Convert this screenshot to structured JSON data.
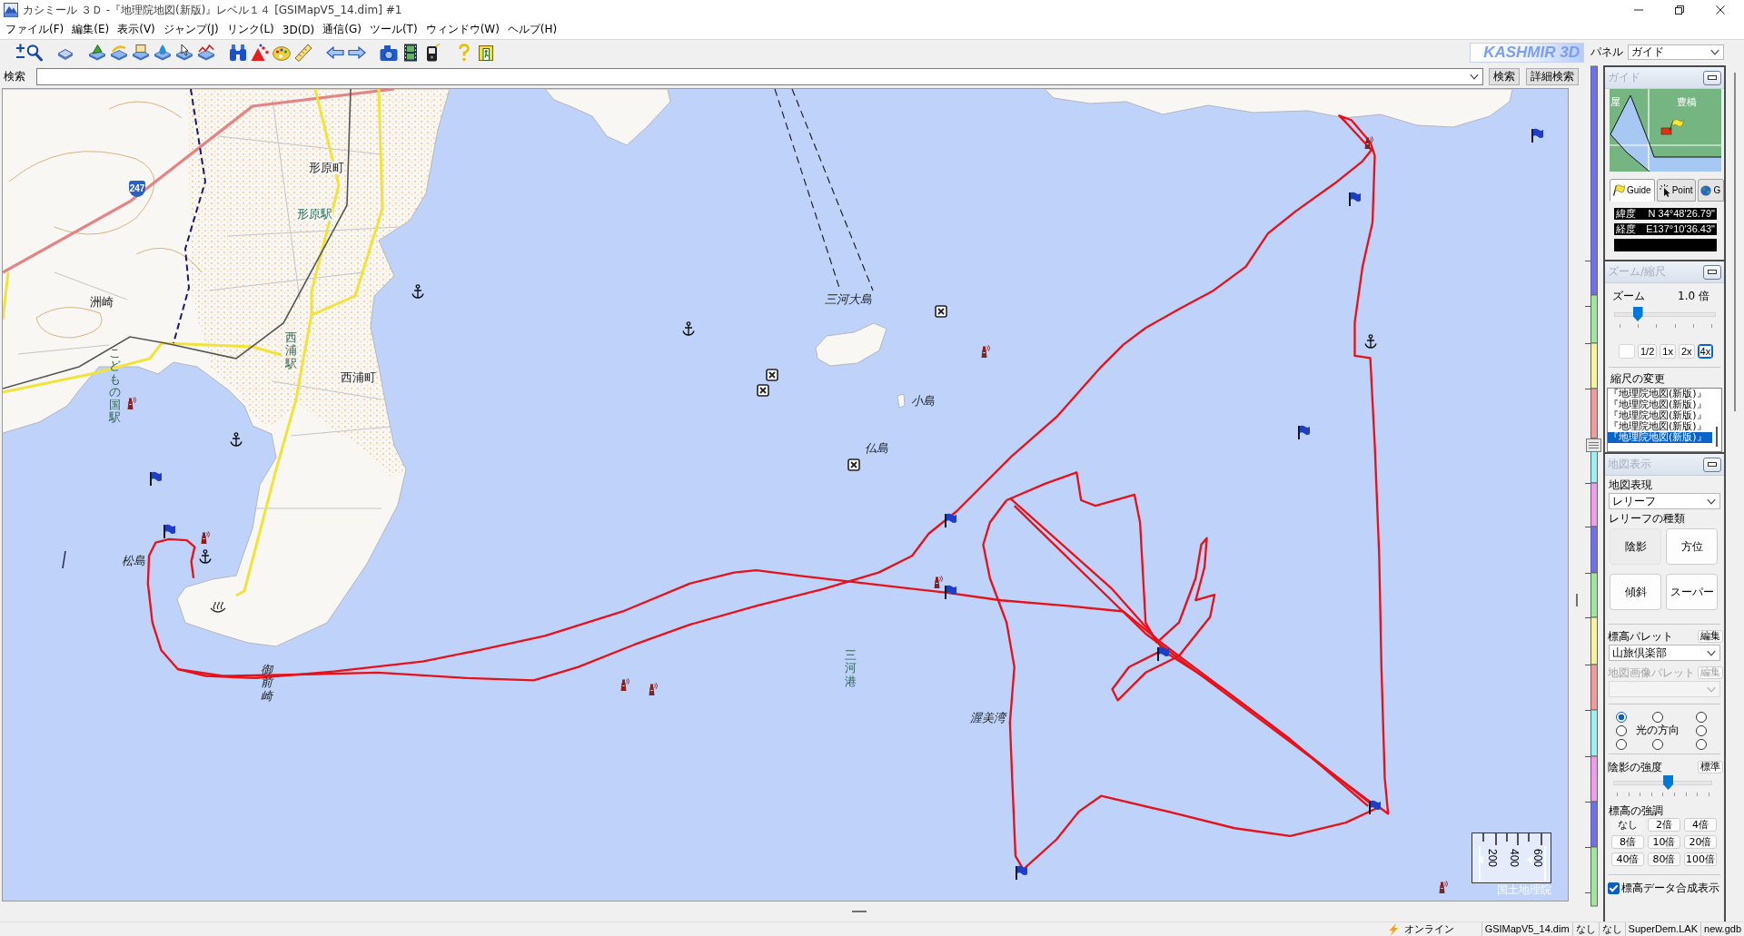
{
  "window": {
    "title": "カシミール ３Ｄ -『地理院地図(新版)』レベル１４ [GSIMapV5_14.dim] #1"
  },
  "menu": [
    "ファイル(F)",
    "編集(E)",
    "表示(V)",
    "ジャンプ(J)",
    "リンク(L)",
    "3D(D)",
    "通信(G)",
    "ツール(T)",
    "ウィンドウ(W)",
    "ヘルプ(H)"
  ],
  "toolbar": {
    "logo": "KASHMIR 3D"
  },
  "panel_selector": {
    "label": "パネル",
    "value": "ガイド"
  },
  "search": {
    "label": "検索",
    "buttons": [
      "検索",
      "詳細検索"
    ]
  },
  "map": {
    "labels": [
      {
        "text": "形原町",
        "kind": "town",
        "vertical": false
      },
      {
        "text": "247",
        "kind": "route"
      },
      {
        "text": "形原駅",
        "kind": "station",
        "vertical": false
      },
      {
        "text": "洲崎",
        "kind": "town",
        "vertical": false
      },
      {
        "text": "三河大島",
        "kind": "natural",
        "vertical": false
      },
      {
        "text": "西浦駅",
        "kind": "station",
        "vertical": true
      },
      {
        "text": "こどもの国駅",
        "kind": "station",
        "vertical": true
      },
      {
        "text": "西浦町",
        "kind": "town",
        "vertical": false
      },
      {
        "text": "小島",
        "kind": "natural",
        "vertical": false
      },
      {
        "text": "仏島",
        "kind": "natural",
        "vertical": false
      },
      {
        "text": "松島",
        "kind": "natural",
        "vertical": false
      },
      {
        "text": "三河港",
        "kind": "port",
        "vertical": true
      },
      {
        "text": "御前崎",
        "kind": "natural",
        "vertical": true
      },
      {
        "text": "渥美湾",
        "kind": "natural",
        "vertical": false
      }
    ],
    "scale_bar": {
      "labels": [
        "200",
        "400",
        "600"
      ]
    },
    "credit": "国土地理院"
  },
  "guide_panel": {
    "title": "ガイド",
    "minimap_labels": [
      "屋",
      "豊橋"
    ],
    "tabs": [
      {
        "label": "Guide",
        "selected": true
      },
      {
        "label": "Point",
        "selected": false
      },
      {
        "label": "G",
        "selected": false
      }
    ],
    "coordinates": [
      {
        "label": "緯度",
        "value": "N 34°48'26.79\""
      },
      {
        "label": "経度",
        "value": "E137°10'36.43\""
      }
    ]
  },
  "zoom_panel": {
    "title": "ズーム/縮尺",
    "zoom_label": "ズーム",
    "zoom_value": "1.0 倍",
    "zoom_slider": {
      "level": 0.2
    },
    "scale_buttons": [
      {
        "label": "1/2",
        "selected": false
      },
      {
        "label": "1x",
        "selected": false
      },
      {
        "label": "2x",
        "selected": false
      },
      {
        "label": "4x",
        "selected": true
      }
    ],
    "scale_list_label": "縮尺の変更",
    "scale_list": [
      {
        "text": "『地理院地図(新版)』",
        "selected": false
      },
      {
        "text": "『地理院地図(新版)』",
        "selected": false
      },
      {
        "text": "『地理院地図(新版)』",
        "selected": false
      },
      {
        "text": "『地理院地図(新版)』",
        "selected": false
      },
      {
        "text": "『地理院地図(新版)』",
        "selected": true
      }
    ]
  },
  "map_display_panel": {
    "title": "地図表示",
    "style_label": "地図表現",
    "style_value": "レリーフ",
    "relief_label": "レリーフの種類",
    "relief_buttons": [
      {
        "label": "陰影",
        "selected": true
      },
      {
        "label": "方位",
        "selected": false
      },
      {
        "label": "傾斜",
        "selected": false
      },
      {
        "label": "スーパー",
        "selected": false
      }
    ],
    "palette": {
      "label": "標高パレット",
      "edit": "編集",
      "value": "山旅倶楽部"
    },
    "image_palette": {
      "label": "地図画像パレット",
      "edit": "編集",
      "disabled": true
    },
    "light_label": "光の方向",
    "light_directions": [
      {
        "selected": true
      },
      {
        "selected": false
      },
      {
        "selected": false
      },
      {
        "selected": false
      },
      {
        "selected": false
      },
      {
        "selected": false
      },
      {
        "selected": false
      },
      {
        "selected": false
      }
    ],
    "shade_label": "陰影の強度",
    "shade_button": "標準",
    "shade_slider": {
      "level": 0.56
    },
    "exaggeration_label": "標高の強調",
    "exaggeration_buttons": [
      {
        "label": "なし",
        "selected": true
      },
      {
        "label": "2倍",
        "selected": false
      },
      {
        "label": "4倍",
        "selected": false
      },
      {
        "label": "8倍",
        "selected": false
      },
      {
        "label": "10倍",
        "selected": false
      },
      {
        "label": "20倍",
        "selected": false
      },
      {
        "label": "40倍",
        "selected": false
      },
      {
        "label": "80倍",
        "selected": false
      },
      {
        "label": "100倍",
        "selected": false
      }
    ],
    "dem_checkbox": {
      "label": "標高データ合成表示",
      "checked": true
    }
  },
  "status_bar": {
    "connection": "オンライン",
    "cells": [
      "GSIMapV5_14.dim",
      "なし",
      "なし",
      "SuperDem.LAK",
      "new.gdb"
    ]
  }
}
